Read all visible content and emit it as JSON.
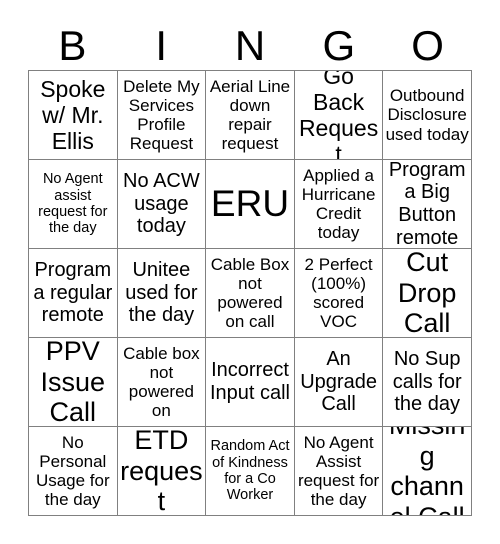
{
  "card": {
    "title_letters": [
      "B",
      "I",
      "N",
      "G",
      "O"
    ],
    "grid": {
      "columns": 5,
      "rows": 5,
      "border_color": "#808080",
      "background_color": "#ffffff",
      "text_color": "#000000",
      "cells": [
        [
          {
            "text": "Spoke w/ Mr. Ellis",
            "size": "lg"
          },
          {
            "text": "Delete My Services Profile Request",
            "size": "sm"
          },
          {
            "text": "Aerial Line down repair request",
            "size": "sm"
          },
          {
            "text": "Go Back Request",
            "size": "lg"
          },
          {
            "text": "Outbound Disclosure used today",
            "size": "sm"
          }
        ],
        [
          {
            "text": "No Agent assist request for the day",
            "size": "xs"
          },
          {
            "text": "No ACW usage today",
            "size": "md"
          },
          {
            "text": "ERU",
            "size": "huge"
          },
          {
            "text": "Applied a Hurricane Credit today",
            "size": "sm"
          },
          {
            "text": "Program a Big Button remote",
            "size": "md"
          }
        ],
        [
          {
            "text": "Program a regular remote",
            "size": "md"
          },
          {
            "text": "Unitee used for the day",
            "size": "md"
          },
          {
            "text": "Cable Box not powered on call",
            "size": "sm"
          },
          {
            "text": "2 Perfect (100%) scored VOC",
            "size": "sm"
          },
          {
            "text": "Cut Drop Call",
            "size": "xl"
          }
        ],
        [
          {
            "text": "PPV Issue Call",
            "size": "xl"
          },
          {
            "text": "Cable box not powered on",
            "size": "sm"
          },
          {
            "text": "Incorrect Input call",
            "size": "md"
          },
          {
            "text": "An Upgrade Call",
            "size": "md"
          },
          {
            "text": "No Sup calls for the day",
            "size": "md"
          }
        ],
        [
          {
            "text": "No Personal Usage for the day",
            "size": "sm"
          },
          {
            "text": "ETD request",
            "size": "xl"
          },
          {
            "text": "Random Act of Kindness for a Co Worker",
            "size": "xs"
          },
          {
            "text": "No Agent Assist request for the day",
            "size": "sm"
          },
          {
            "text": "Missing channel Call",
            "size": "xl"
          }
        ]
      ]
    }
  }
}
